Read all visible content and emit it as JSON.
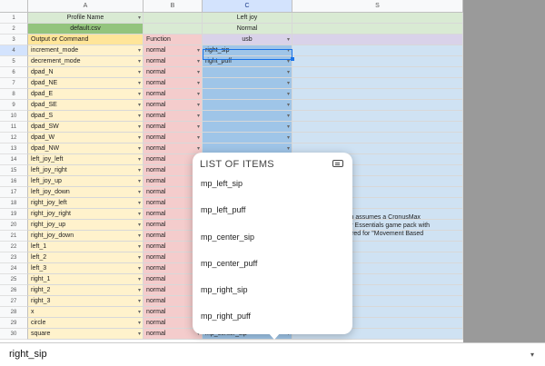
{
  "columns": [
    "A",
    "B",
    "C",
    "S"
  ],
  "rows": [
    {
      "n": "1",
      "a": "Profile Name",
      "b": "",
      "c": "Left joy",
      "s": ""
    },
    {
      "n": "2",
      "a": "default.csv",
      "b": "",
      "c": "Normal",
      "s": ""
    },
    {
      "n": "3",
      "a": "Output or Command",
      "b": "Function",
      "c": "usb",
      "s": ""
    },
    {
      "n": "4",
      "a": "increment_mode",
      "b": "normal",
      "c": "right_sip",
      "s": ""
    },
    {
      "n": "5",
      "a": "decrement_mode",
      "b": "normal",
      "c": "right_puff",
      "s": ""
    },
    {
      "n": "6",
      "a": "dpad_N",
      "b": "normal",
      "c": "",
      "s": ""
    },
    {
      "n": "7",
      "a": "dpad_NE",
      "b": "normal",
      "c": "",
      "s": ""
    },
    {
      "n": "8",
      "a": "dpad_E",
      "b": "normal",
      "c": "",
      "s": ""
    },
    {
      "n": "9",
      "a": "dpad_SE",
      "b": "normal",
      "c": "",
      "s": ""
    },
    {
      "n": "10",
      "a": "dpad_S",
      "b": "normal",
      "c": "",
      "s": ""
    },
    {
      "n": "11",
      "a": "dpad_SW",
      "b": "normal",
      "c": "",
      "s": ""
    },
    {
      "n": "12",
      "a": "dpad_W",
      "b": "normal",
      "c": "",
      "s": ""
    },
    {
      "n": "13",
      "a": "dpad_NW",
      "b": "normal",
      "c": "",
      "s": ""
    },
    {
      "n": "14",
      "a": "left_joy_left",
      "b": "normal",
      "c": "",
      "s": ""
    },
    {
      "n": "15",
      "a": "left_joy_right",
      "b": "normal",
      "c": "",
      "s": ""
    },
    {
      "n": "16",
      "a": "left_joy_up",
      "b": "normal",
      "c": "",
      "s": ""
    },
    {
      "n": "17",
      "a": "left_joy_down",
      "b": "normal",
      "c": "",
      "s": ""
    },
    {
      "n": "18",
      "a": "right_joy_left",
      "b": "normal",
      "c": "",
      "s": ""
    },
    {
      "n": "19",
      "a": "right_joy_right",
      "b": "normal",
      "c": "",
      "s": ""
    },
    {
      "n": "20",
      "a": "right_joy_up",
      "b": "normal",
      "c": "",
      "s": ""
    },
    {
      "n": "21",
      "a": "right_joy_down",
      "b": "normal",
      "c": "",
      "s": ""
    },
    {
      "n": "22",
      "a": "left_1",
      "b": "normal",
      "c": "",
      "s": ""
    },
    {
      "n": "23",
      "a": "left_2",
      "b": "normal",
      "c": "",
      "s": ""
    },
    {
      "n": "24",
      "a": "left_3",
      "b": "normal",
      "c": "",
      "s": ""
    },
    {
      "n": "25",
      "a": "right_1",
      "b": "normal",
      "c": "",
      "s": ""
    },
    {
      "n": "26",
      "a": "right_2",
      "b": "normal",
      "c": "",
      "s": ""
    },
    {
      "n": "27",
      "a": "right_3",
      "b": "normal",
      "c": "",
      "s": ""
    },
    {
      "n": "28",
      "a": "x",
      "b": "normal",
      "c": "",
      "s": ""
    },
    {
      "n": "29",
      "a": "circle",
      "b": "normal",
      "c": "",
      "s": ""
    },
    {
      "n": "30",
      "a": "square",
      "b": "normal",
      "c": "mp_center_sip",
      "s": ""
    }
  ],
  "description_lines": [
    "uration assumes a CronusMax",
    "ssover Essentials game pack with",
    "onfigured for \"Movement Based"
  ],
  "list": {
    "title": "LIST OF ITEMS",
    "items": [
      "mp_left_sip",
      "mp_left_puff",
      "mp_center_sip",
      "mp_center_puff",
      "mp_right_sip",
      "mp_right_puff"
    ]
  },
  "bottom_value": "right_sip",
  "icons": {
    "dropdown": "▾",
    "keyboard": "keyboard-icon"
  },
  "colors": {
    "selection": "#1a73e8",
    "colA": "#fff2cc",
    "colB": "#f4cccc",
    "colC": "#9fc5e8"
  }
}
